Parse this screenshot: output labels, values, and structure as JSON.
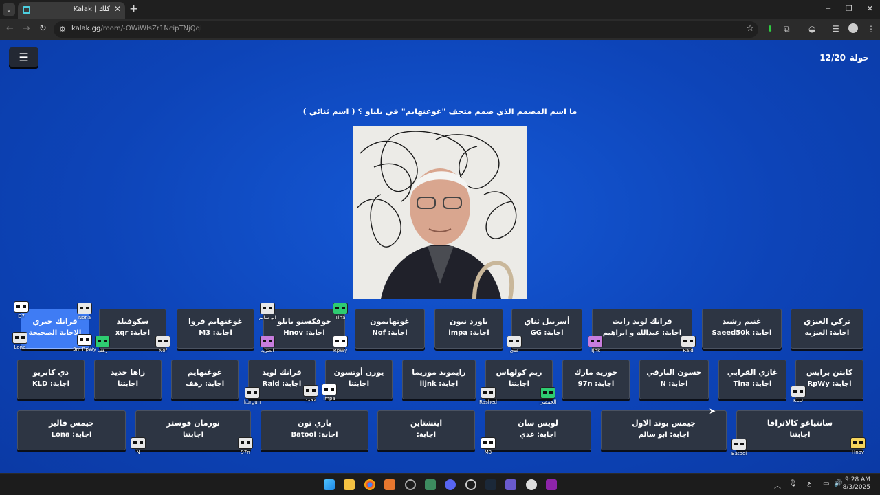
{
  "browser": {
    "tab_title": "Kalak | كلك",
    "url_host": "kalak.gg",
    "url_path": "/room/-OWiWlsZr1NcipTNjQqi"
  },
  "game": {
    "round_label": "جولة",
    "round_value": "12/20",
    "question": "ما اسم المصمم الذي صمم متحف \"غوغنهايم\" في بلباو ؟ ( اسم ثنائي )",
    "answers": [
      {
        "name": "تركي العنزي",
        "sub": "اجابة: العنزيه"
      },
      {
        "name": "غنيم رشيد",
        "sub": "اجابة: Saeed50k"
      },
      {
        "name": "فرانك لويد رايت",
        "sub": "اجابة: عبدالله و ابراهيم"
      },
      {
        "name": "أسزييل ثناي",
        "sub": "اجابة: GG"
      },
      {
        "name": "باورد نيون",
        "sub": "اجابة: impa"
      },
      {
        "name": "غوتهايمون",
        "sub": "اجابة: Nof"
      },
      {
        "name": "جوفكسنو بابلو",
        "sub": "اجابة: Hnov"
      },
      {
        "name": "غوغنهايم فروا",
        "sub": "اجابة: M3"
      },
      {
        "name": "سكوفيلد",
        "sub": "اجابة: xqr"
      },
      {
        "name": "فرانك جيري",
        "sub": "الاجابة الصحيحة"
      },
      {
        "name": "كابتن برايس",
        "sub": "اجابة: RpWy"
      },
      {
        "name": "غازي القرابي",
        "sub": "اجابة: Tina"
      },
      {
        "name": "حسون البارقي",
        "sub": "اجابة: N"
      },
      {
        "name": "خوزيه مارك",
        "sub": "اجابة: 97n"
      },
      {
        "name": "ريم كولهاس",
        "sub": "اجابتنا"
      },
      {
        "name": "رايموند موريما",
        "sub": "اجابة: iijnk"
      },
      {
        "name": "يورن أوتسون",
        "sub": "اجابتنا"
      },
      {
        "name": "فرانك لويد",
        "sub": "اجابة: Raid"
      },
      {
        "name": "غوغنهايم",
        "sub": "اجابة: رهف"
      },
      {
        "name": "زاها حديد",
        "sub": "اجابتنا"
      },
      {
        "name": "دي كابريو",
        "sub": "اجابة: KLD"
      },
      {
        "name": "سانتياغو كالاترافا",
        "sub": "اجابتنا"
      },
      {
        "name": "جيمس بوند الاول",
        "sub": "اجابة: ابو سالم"
      },
      {
        "name": "لويس سان",
        "sub": "اجابة: غدي"
      },
      {
        "name": "اينشتاين",
        "sub": "اجابة:"
      },
      {
        "name": "باري تون",
        "sub": "اجابة: Batool"
      },
      {
        "name": "نورمان فوستر",
        "sub": "اجابتنا"
      },
      {
        "name": "جيمس فالير",
        "sub": "اجابة: Lona"
      }
    ],
    "players": [
      "D7",
      "Nona",
      "Lona",
      "3m RpWy",
      "رهف",
      "Nof",
      "ابو سالم",
      "Tina",
      "العنزيه",
      "RpWy",
      "غدي",
      "iijnk",
      "Raid",
      "kurgun",
      "محمد",
      "impa",
      "Rashed",
      "الحمصي",
      "KLD",
      "N",
      "97n",
      "M3",
      "Batool",
      "Hnov"
    ]
  },
  "taskbar": {
    "time": "9:28 AM",
    "date": "8/3/2025"
  },
  "colors": {
    "bg": "#0d44b8",
    "card": "#2d3543",
    "selected": "#3f7cf4"
  }
}
